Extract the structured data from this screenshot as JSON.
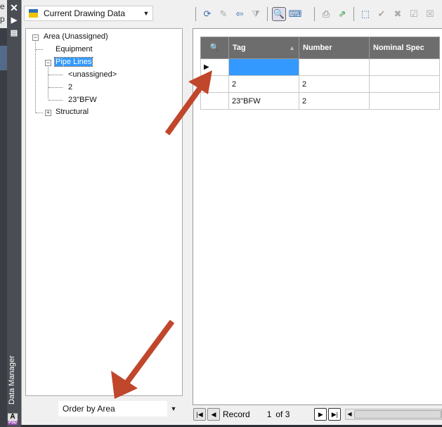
{
  "palette": {
    "title": "Data Manager",
    "close_icon": "close-icon",
    "badge": "A",
    "badge_sub": "P3D"
  },
  "source_combo": {
    "value": "Current Drawing Data"
  },
  "tree": {
    "root": "Area (Unassigned)",
    "items": [
      "Equipment",
      "Pipe Lines",
      "<unassigned>",
      "2",
      "23\"BFW",
      "Structural"
    ],
    "selected": "Pipe Lines"
  },
  "order_combo": {
    "value": "Order by Area"
  },
  "grid": {
    "columns": [
      "Tag",
      "Number",
      "Nominal Spec"
    ],
    "sorted_column": "Tag",
    "rows": [
      [
        "",
        "",
        ""
      ],
      [
        "2",
        "2",
        ""
      ],
      [
        "23\"BFW",
        "2",
        ""
      ]
    ]
  },
  "navigator": {
    "label": "Record",
    "current": "1",
    "of": "of 3"
  },
  "colors": {
    "selection": "#3399ff",
    "header": "#6d6d6d",
    "annotation_arrow": "#c0462c"
  }
}
